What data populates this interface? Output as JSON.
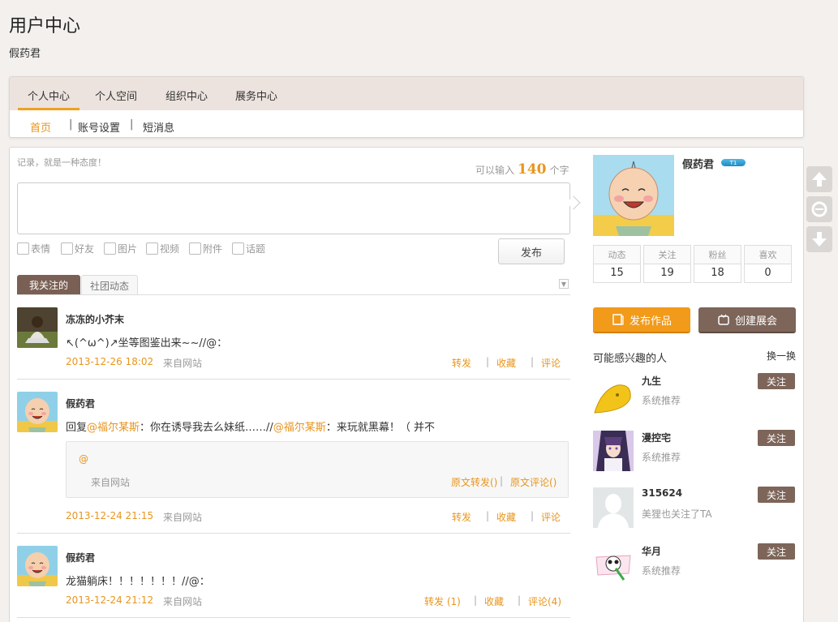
{
  "header": {
    "title": "用户中心",
    "username": "假药君"
  },
  "nav": {
    "tabs": [
      "个人中心",
      "个人空间",
      "组织中心",
      "展务中心"
    ],
    "subnav": [
      "首页",
      "账号设置",
      "短消息"
    ],
    "separator": "|"
  },
  "composer": {
    "hint": "记录，就是一种态度！",
    "counter_prefix": "可以输入",
    "counter_value": "140",
    "counter_suffix": "个字",
    "tools": [
      "表情",
      "好友",
      "图片",
      "视频",
      "附件",
      "话题"
    ],
    "publish_label": "发布"
  },
  "feed_tabs": [
    "我关注的",
    "社团动态"
  ],
  "feed_dropdown_icon": "▼",
  "feed": [
    {
      "name": "冻冻的小芥末",
      "text": "↖(^ω^)↗坐等图鉴出来~~//@：",
      "time": "2013-12-26 18:02",
      "source": "来自网站",
      "actions": [
        "转发",
        "收藏",
        "评论"
      ]
    },
    {
      "name": "假药君",
      "text_parts": [
        "回复",
        "@福尔某斯",
        "：你在诱导我去么妹纸……//",
        "@福尔某斯",
        "：来玩就黑幕！（ 并不"
      ],
      "quote": {
        "at": "@",
        "source": "来自网站",
        "actions": [
          "原文转发()",
          "原文评论()"
        ]
      },
      "time": "2013-12-24 21:15",
      "source": "来自网站",
      "actions": [
        "转发",
        "收藏",
        "评论"
      ]
    },
    {
      "name": "假药君",
      "text": "龙猫躺床！！！！！！！//@：",
      "time": "2013-12-24 21:12",
      "source": "来自网站",
      "actions": [
        "转发 (1)",
        "收藏",
        "评论(4)"
      ]
    }
  ],
  "profile": {
    "name": "假药君",
    "badge": "T1",
    "stats": [
      {
        "label": "动态",
        "value": "15"
      },
      {
        "label": "关注",
        "value": "19"
      },
      {
        "label": "粉丝",
        "value": "18"
      },
      {
        "label": "喜欢",
        "value": "0"
      }
    ],
    "publish_work": "发布作品",
    "create_expo": "创建展会"
  },
  "recommend": {
    "title": "可能感兴趣的人",
    "swap": "换一换",
    "follow_label": "关注",
    "people": [
      {
        "name": "九生",
        "desc": "系统推荐"
      },
      {
        "name": "漫控宅",
        "desc": "系统推荐"
      },
      {
        "name": "315624",
        "desc": "美狸也关注了TA"
      },
      {
        "name": "华月",
        "desc": "系统推荐"
      }
    ]
  },
  "colors": {
    "accent": "#e8951d",
    "brown": "#7d6559",
    "orange_btn": "#f29a1a"
  }
}
